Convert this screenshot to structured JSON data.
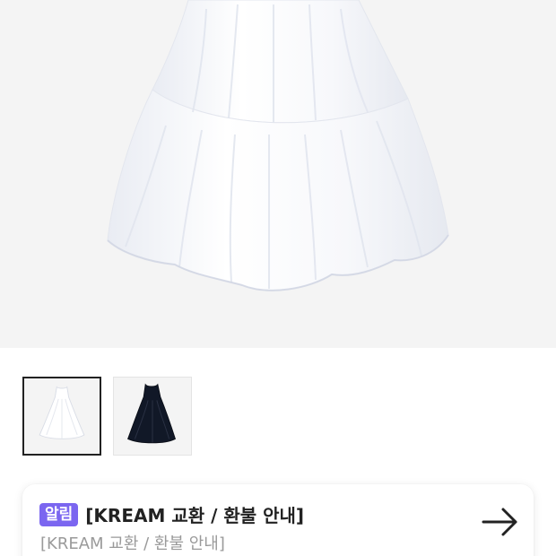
{
  "product": {
    "main_image": "white-tiered-dress-photo",
    "thumbnails": [
      {
        "name": "white-dress-thumbnail",
        "color": "#ffffff",
        "selected": true
      },
      {
        "name": "black-dress-thumbnail",
        "color": "#111827",
        "selected": false
      }
    ]
  },
  "notice": {
    "badge": "알림",
    "title": "[KREAM 교환 / 환불 안내]",
    "subtitle": "[KREAM 교환 / 환불 안내]",
    "arrow_icon": "arrow-right-icon",
    "badge_color": "#7b66f0"
  }
}
